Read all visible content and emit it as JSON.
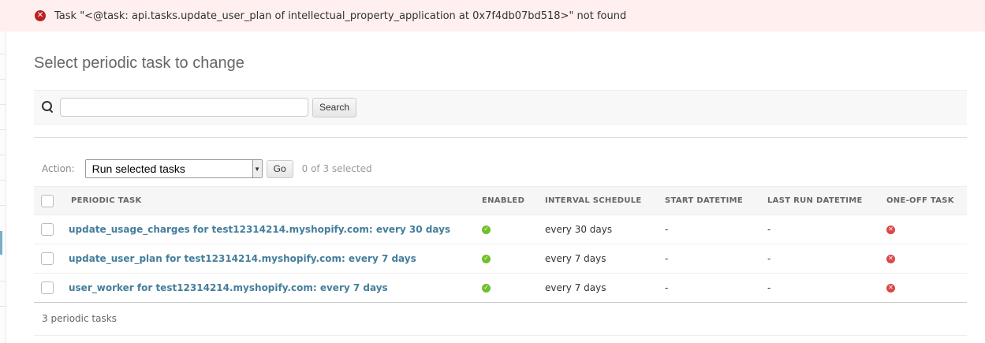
{
  "message": {
    "text": "Task \"<@task: api.tasks.update_user_plan of intellectual_property_application at 0x7f4db07bd518>\" not found",
    "icon": "error-icon",
    "color": "#ba2121"
  },
  "page": {
    "title": "Select periodic task to change"
  },
  "search": {
    "value": "",
    "button_label": "Search"
  },
  "actions": {
    "label": "Action:",
    "selected": "Run selected tasks",
    "go_label": "Go",
    "counter": "0 of 3 selected"
  },
  "table": {
    "headers": [
      "PERIODIC TASK",
      "ENABLED",
      "INTERVAL SCHEDULE",
      "START DATETIME",
      "LAST RUN DATETIME",
      "ONE-OFF TASK"
    ],
    "rows": [
      {
        "name": "update_usage_charges for test12314214.myshopify.com: every 30 days",
        "enabled": true,
        "interval": "every 30 days",
        "start": "-",
        "last_run": "-",
        "one_off": false
      },
      {
        "name": "update_user_plan for test12314214.myshopify.com: every 7 days",
        "enabled": true,
        "interval": "every 7 days",
        "start": "-",
        "last_run": "-",
        "one_off": false
      },
      {
        "name": "user_worker for test12314214.myshopify.com: every 7 days",
        "enabled": true,
        "interval": "every 7 days",
        "start": "-",
        "last_run": "-",
        "one_off": false
      }
    ]
  },
  "paginator": {
    "text": "3 periodic tasks"
  },
  "colors": {
    "link": "#447e9b",
    "yes": "#70bf2b",
    "no": "#dd4646",
    "error_bg": "#ffefef"
  }
}
